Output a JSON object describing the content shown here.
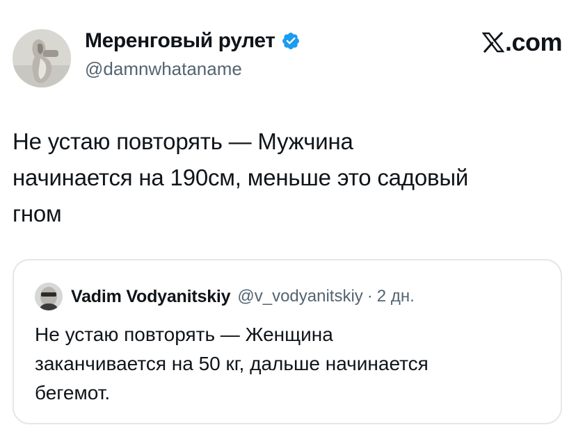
{
  "author": {
    "display_name": "Меренговый рулет",
    "handle": "@damnwhataname",
    "verified_icon": "verified-badge-icon",
    "avatar": "profile-photo"
  },
  "brand": {
    "logo_icon": "x-logo-icon",
    "text": ".com"
  },
  "tweet": {
    "text": "Не устаю повторять — Мужчина\nначинается на 190см, меньше это садовый\nгном"
  },
  "quoted_tweet": {
    "avatar": "profile-photo",
    "display_name": "Vadim Vodyanitskiy",
    "handle": "@v_vodyanitskiy",
    "separator": "·",
    "time": "2 дн.",
    "text": "Не устаю повторять — Женщина\nзаканчивается на 50 кг, дальше начинается\nбегемот."
  },
  "colors": {
    "text_primary": "#0f1419",
    "text_secondary": "#536471",
    "verified": "#1d9bf0",
    "card_border": "#e3e7ea"
  }
}
